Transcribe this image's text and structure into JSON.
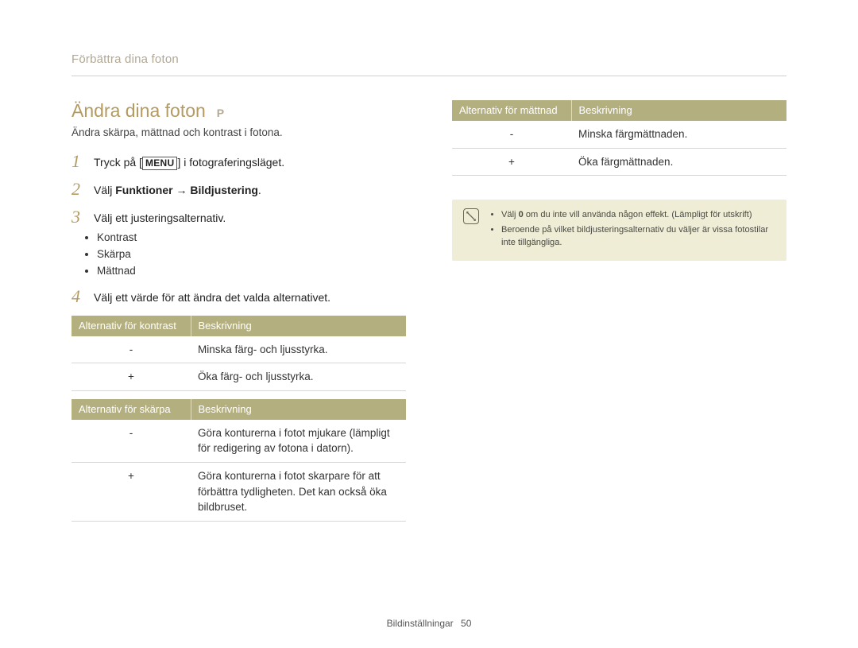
{
  "breadcrumb": "Förbättra dina foton",
  "title": "Ändra dina foton",
  "mode_badge": "P",
  "subtitle": "Ändra skärpa, mättnad och kontrast i fotona.",
  "steps": {
    "s1": {
      "num": "1",
      "pre": "Tryck på [",
      "menu": "MENU",
      "post": "] i fotograferingsläget."
    },
    "s2": {
      "num": "2",
      "pre": "Välj ",
      "bold1": "Funktioner",
      "arrow": " → ",
      "bold2": "Bildjustering",
      "post": "."
    },
    "s3": {
      "num": "3",
      "text": "Välj ett justeringsalternativ."
    },
    "s4": {
      "num": "4",
      "text": "Välj ett värde för att ändra det valda alternativet."
    }
  },
  "bullets": [
    "Kontrast",
    "Skärpa",
    "Mättnad"
  ],
  "tables": {
    "contrast": {
      "h1": "Alternativ för kontrast",
      "h2": "Beskrivning",
      "rows": [
        {
          "k": "-",
          "v": "Minska färg- och ljusstyrka."
        },
        {
          "k": "+",
          "v": "Öka färg- och ljusstyrka."
        }
      ]
    },
    "sharp": {
      "h1": "Alternativ för skärpa",
      "h2": "Beskrivning",
      "rows": [
        {
          "k": "-",
          "v": "Göra konturerna i fotot mjukare (lämpligt för redigering av fotona i datorn)."
        },
        {
          "k": "+",
          "v": "Göra konturerna i fotot skarpare för att förbättra tydligheten. Det kan också öka bildbruset."
        }
      ]
    },
    "sat": {
      "h1": "Alternativ för mättnad",
      "h2": "Beskrivning",
      "rows": [
        {
          "k": "-",
          "v": "Minska färgmättnaden."
        },
        {
          "k": "+",
          "v": "Öka färgmättnaden."
        }
      ]
    }
  },
  "note": {
    "items": [
      {
        "pre": "Välj ",
        "bold": "0",
        "post": " om du inte vill använda någon effekt. (Lämpligt för utskrift)"
      },
      {
        "pre": "",
        "bold": "",
        "post": "Beroende på vilket bildjusteringsalternativ du väljer är vissa fotostilar inte tillgängliga."
      }
    ]
  },
  "footer": {
    "section": "Bildinställningar",
    "page": "50"
  }
}
